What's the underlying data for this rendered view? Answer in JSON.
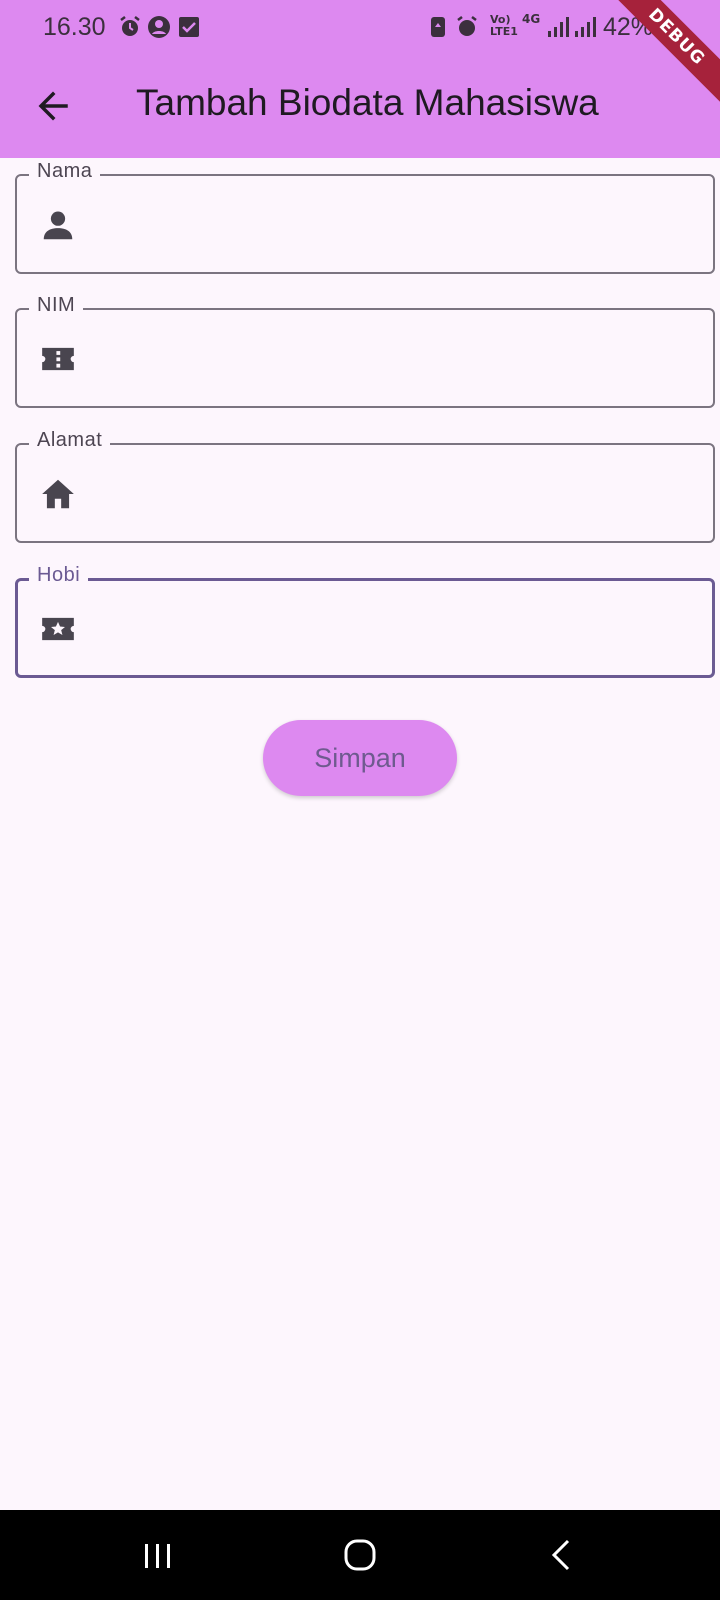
{
  "status_bar": {
    "time": "16.30",
    "network_label": "Vo) LTE1",
    "network_type": "4G",
    "battery": "42%"
  },
  "debug_banner": "DEBUG",
  "app_bar": {
    "title": "Tambah Biodata Mahasiswa",
    "back_icon": "arrow-back-icon"
  },
  "form": {
    "fields": [
      {
        "label": "Nama",
        "icon": "person-icon",
        "value": ""
      },
      {
        "label": "NIM",
        "icon": "badge-ticket-icon",
        "value": ""
      },
      {
        "label": "Alamat",
        "icon": "home-icon",
        "value": ""
      },
      {
        "label": "Hobi",
        "icon": "star-ticket-icon",
        "value": "",
        "focused": true
      }
    ],
    "submit_label": "Simpan"
  },
  "colors": {
    "app_bar": "#dd89f0",
    "background": "#fdf6fd",
    "focused_border": "#6b5a93",
    "button_text": "#6e5a8f",
    "debug_banner": "#a6223b"
  },
  "nav_bar": {
    "recents_icon": "recents-icon",
    "home_icon": "home-circle-icon",
    "back_icon": "nav-back-icon"
  }
}
